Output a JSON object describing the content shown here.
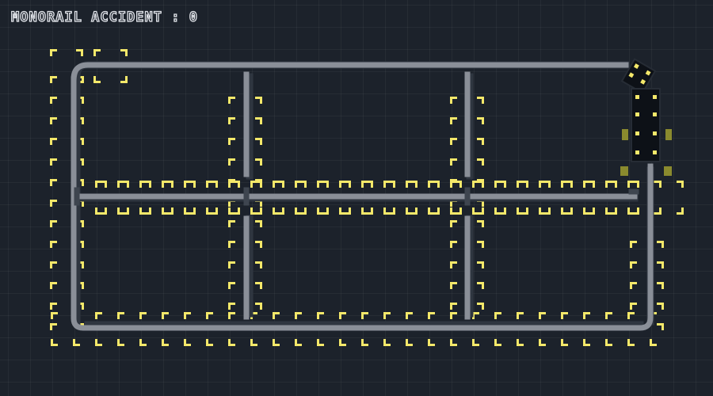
{
  "hud": {
    "label": "MONORAIL ACCIDENT",
    "separator": " : ",
    "count": "0"
  },
  "colors": {
    "background": "#1c222b",
    "grid_line": "#272e38",
    "track": "#8a8f98",
    "marker": "#f4e86a",
    "train_body": "#0d1117",
    "switch_pad": "#8a8a2e"
  },
  "icons": {
    "train": "monorail-train",
    "marker": "corner-bracket-marker",
    "switch": "switch-pad"
  }
}
